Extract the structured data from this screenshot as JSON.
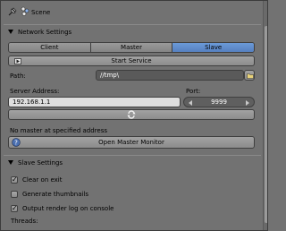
{
  "breadcrumb": {
    "scene_label": "Scene"
  },
  "network_panel": {
    "title": "Network Settings",
    "modes": [
      {
        "label": "Client",
        "active": false
      },
      {
        "label": "Master",
        "active": false
      },
      {
        "label": "Slave",
        "active": true
      }
    ],
    "start_service_label": "Start Service",
    "path_label": "Path:",
    "path_value": "//tmp\\",
    "server_address_label": "Server Address:",
    "server_address_value": "192.168.1.1",
    "port_label": "Port:",
    "port_value": "9999",
    "status_text": "No master at specified address",
    "open_monitor_label": "Open Master Monitor"
  },
  "slave_panel": {
    "title": "Slave Settings",
    "options": [
      {
        "label": "Clear on exit",
        "checked": true
      },
      {
        "label": "Generate thumbnails",
        "checked": false
      },
      {
        "label": "Output render log on console",
        "checked": true
      }
    ],
    "threads_label": "Threads:"
  },
  "colors": {
    "background": "#727272",
    "active_tab": "#5680c0",
    "button": "#9a9a9a",
    "dark_field": "#5a5a5a",
    "light_field": "#dedede"
  },
  "icons": {
    "pin": "pin-icon",
    "scene": "scene-icon",
    "collapse": "triangle-down-icon",
    "start": "play-icon",
    "folder": "folder-icon",
    "refresh": "refresh-icon",
    "help": "help-icon",
    "check": "checkmark-icon"
  }
}
